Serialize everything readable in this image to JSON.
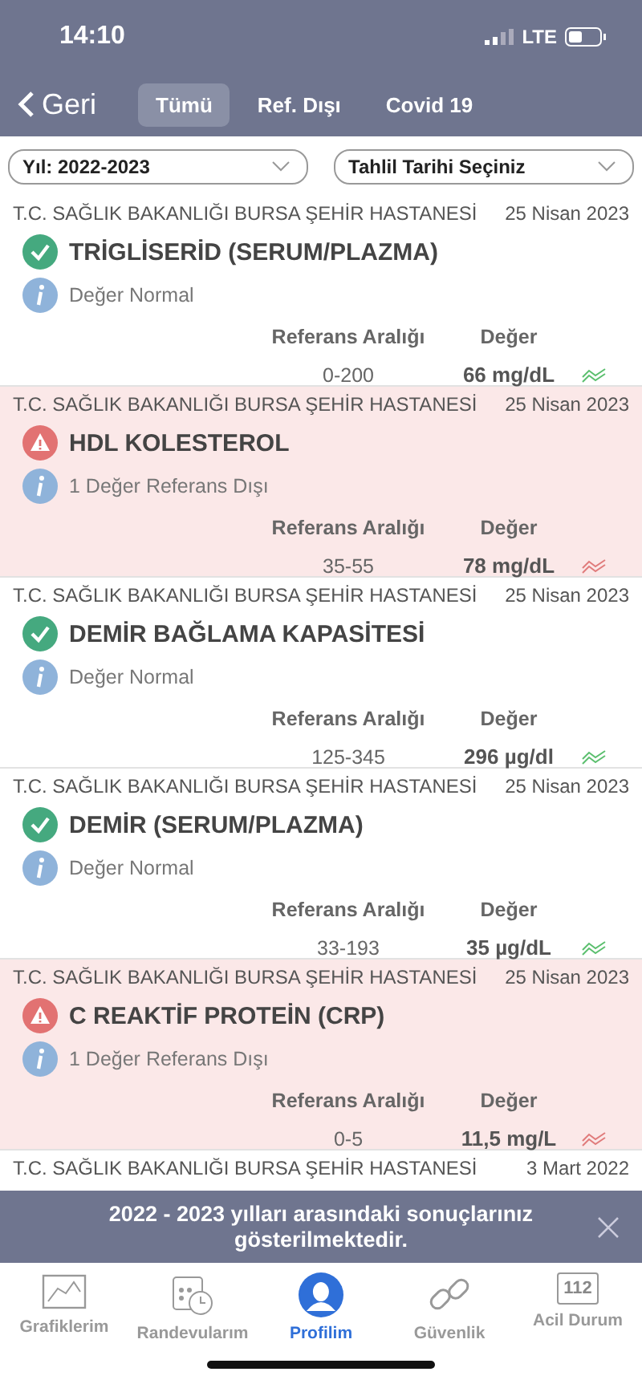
{
  "status_bar": {
    "time": "14:10",
    "network": "LTE"
  },
  "nav": {
    "back": "Geri",
    "tabs": [
      {
        "label": "Tümü",
        "selected": true
      },
      {
        "label": "Ref. Dışı",
        "selected": false
      },
      {
        "label": "Covid 19",
        "selected": false
      }
    ]
  },
  "filters": [
    {
      "value": "Yıl: 2022-2023"
    },
    {
      "value": "Tahlil Tarihi Seçiniz"
    }
  ],
  "results": [
    {
      "hospital": "T.C. SAĞLIK BAKANLIĞI BURSA ŞEHİR HASTANESİ",
      "date": "25 Nisan 2023",
      "test": "TRİGLİSERİD (SERUM/PLAZMA)",
      "kind": "normal",
      "note": "Değer Normal",
      "range_label": "Referans Aralığı",
      "value_label": "Değer",
      "range": "0-200",
      "value": "66 mg/dL"
    },
    {
      "hospital": "T.C. SAĞLIK BAKANLIĞI BURSA ŞEHİR HASTANESİ",
      "date": "25 Nisan 2023",
      "test": "HDL KOLESTEROL",
      "kind": "out_of_range",
      "note": "1 Değer Referans Dışı",
      "range_label": "Referans Aralığı",
      "value_label": "Değer",
      "range": "35-55",
      "value": "78 mg/dL"
    },
    {
      "hospital": "T.C. SAĞLIK BAKANLIĞI BURSA ŞEHİR HASTANESİ",
      "date": "25 Nisan 2023",
      "test": "DEMİR BAĞLAMA KAPASİTESİ",
      "kind": "normal",
      "note": "Değer Normal",
      "range_label": "Referans Aralığı",
      "value_label": "Değer",
      "range": "125-345",
      "value": "296 µg/dl"
    },
    {
      "hospital": "T.C. SAĞLIK BAKANLIĞI BURSA ŞEHİR HASTANESİ",
      "date": "25 Nisan 2023",
      "test": "DEMİR (SERUM/PLAZMA)",
      "kind": "normal",
      "note": "Değer Normal",
      "range_label": "Referans Aralığı",
      "value_label": "Değer",
      "range": "33-193",
      "value": "35 µg/dL"
    },
    {
      "hospital": "T.C. SAĞLIK BAKANLIĞI BURSA ŞEHİR HASTANESİ",
      "date": "25 Nisan 2023",
      "test": "C REAKTİF PROTEİN (CRP)",
      "kind": "out_of_range",
      "note": "1 Değer Referans Dışı",
      "range_label": "Referans Aralığı",
      "value_label": "Değer",
      "range": "0-5",
      "value": "11,5 mg/L"
    },
    {
      "hospital": "T.C. SAĞLIK BAKANLIĞI BURSA ŞEHİR HASTANESİ",
      "date": "3 Mart 2022"
    }
  ],
  "banner": {
    "message": "2022 - 2023 yılları arasındaki sonuçlarınız gösterilmektedir."
  },
  "tab_bar": [
    {
      "kind": "chart",
      "label": "Grafiklerim",
      "selected": false
    },
    {
      "kind": "calendar",
      "label": "Randevularım",
      "selected": false
    },
    {
      "kind": "profile",
      "label": "Profilim",
      "selected": true
    },
    {
      "kind": "link",
      "label": "Güvenlik",
      "selected": false
    },
    {
      "kind": "emergency",
      "label": "Acil Durum",
      "badge": "112",
      "selected": false
    }
  ]
}
